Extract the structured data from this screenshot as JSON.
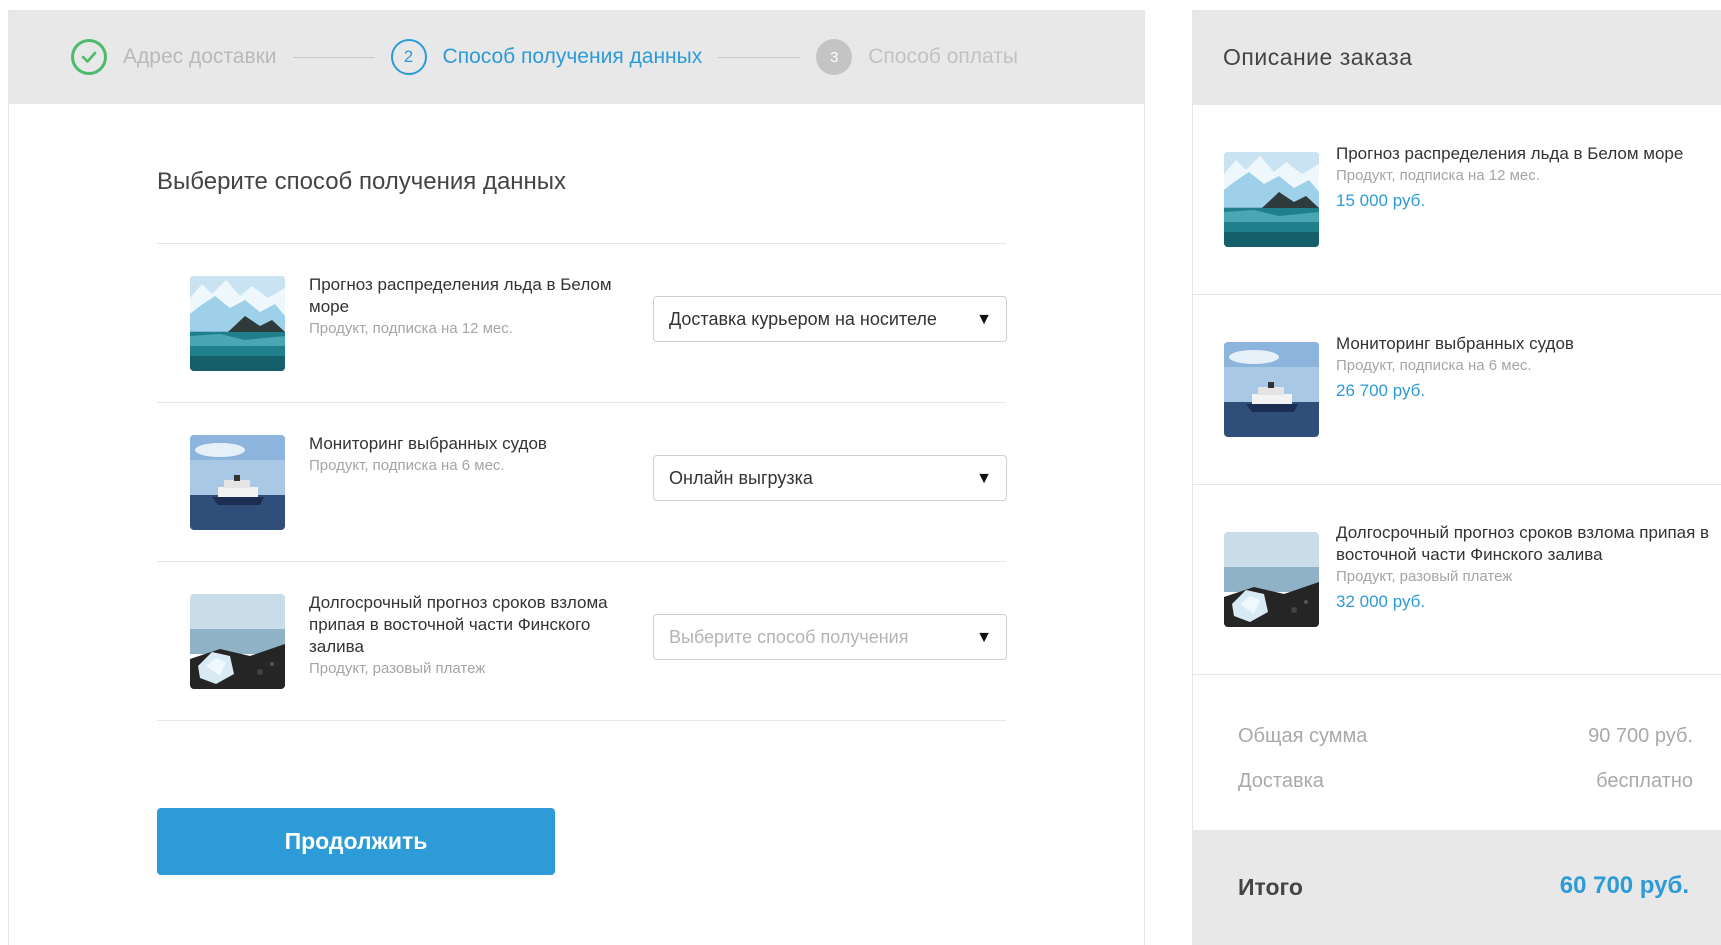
{
  "stepper": {
    "steps": [
      {
        "label": "Адрес доставки",
        "state": "done"
      },
      {
        "label": "Способ получения данных",
        "number": "2",
        "state": "active"
      },
      {
        "label": "Способ оплаты",
        "number": "3",
        "state": "pending"
      }
    ]
  },
  "main": {
    "title": "Выберите способ получения данных",
    "products": [
      {
        "name": "Прогноз распределения льда в Белом море",
        "meta": "Продукт, подписка на 12 мес.",
        "delivery": "Доставка курьером на носителе",
        "image": "glacier-icon"
      },
      {
        "name": "Мониторинг выбранных судов",
        "meta": "Продукт, подписка на 6 мес.",
        "delivery": "Онлайн выгрузка",
        "image": "ship-icon"
      },
      {
        "name": "Долгосрочный прогноз сроков взлома припая в восточной части Финского залива",
        "meta": "Продукт, разовый платеж",
        "delivery": "",
        "placeholder": "Выберите способ получения",
        "image": "ice-shore-icon"
      }
    ],
    "continue_label": "Продолжить"
  },
  "summary": {
    "title": "Описание заказа",
    "items": [
      {
        "name": "Прогноз распределения льда в Белом море",
        "meta": "Продукт, подписка на 12 мес.",
        "price": "15 000 руб."
      },
      {
        "name": "Мониторинг выбранных судов",
        "meta": "Продукт, подписка на 6 мес.",
        "price": "26 700 руб."
      },
      {
        "name": "Долгосрочный прогноз сроков взлома припая в восточной части Финского залива",
        "meta": "Продукт, разовый платеж",
        "price": "32 000 руб."
      }
    ],
    "subtotal_label": "Общая сумма",
    "subtotal_value": "90 700 руб.",
    "delivery_label": "Доставка",
    "delivery_value": "бесплатно",
    "total_label": "Итого",
    "total_value": "60 700 руб."
  },
  "colors": {
    "accent": "#2c9bd8",
    "success": "#4cbb6c",
    "header_bg": "#e8e8e8"
  }
}
